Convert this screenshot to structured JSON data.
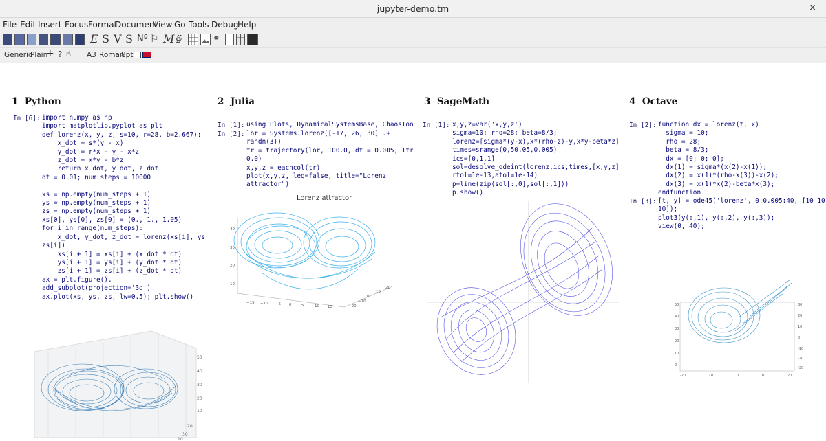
{
  "window": {
    "title": "jupyter-demo.tm",
    "close_glyph": "×"
  },
  "menu": [
    "File",
    "Edit",
    "Insert",
    "Focus",
    "Format",
    "Document",
    "View",
    "Go",
    "Tools",
    "Debug",
    "Help"
  ],
  "toolbar": {
    "letters": [
      "E",
      "S",
      "V",
      "S",
      "M"
    ],
    "icons": [
      "new-document-icon",
      "open-icon",
      "save-icon",
      "print-icon",
      "export-icon",
      "image-icon",
      "link-icon",
      "table-icon",
      "screen-icon"
    ]
  },
  "format_bar": {
    "style": "Generic",
    "mode": "Plain",
    "add_glyph": "+",
    "help_glyph": "?",
    "paper": "A3",
    "font": "Roman",
    "size": "8pt"
  },
  "sections": [
    {
      "number": "1",
      "title": "Python",
      "prompt": "In [6]:",
      "code": "import numpy as np\nimport matplotlib.pyplot as plt\ndef lorenz(x, y, z, s=10, r=28, b=2.667):\n    x_dot = s*(y - x)\n    y_dot = r*x - y - x*z\n    z_dot = x*y - b*z\n    return x_dot, y_dot, z_dot\ndt = 0.01; num_steps = 10000\n\nxs = np.empty(num_steps + 1)\nys = np.empty(num_steps + 1)\nzs = np.empty(num_steps + 1)\nxs[0], ys[0], zs[0] = (0., 1., 1.05)\nfor i in range(num_steps):\n    x_dot, y_dot, z_dot = lorenz(xs[i], ys[i],\nzs[i])\n    xs[i + 1] = xs[i] + (x_dot * dt)\n    ys[i + 1] = ys[i] + (y_dot * dt)\n    zs[i + 1] = zs[i] + (z_dot * dt)\nax = plt.figure().\nadd_subplot(projection='3d')\nax.plot(xs, ys, zs, lw=0.5); plt.show()"
    },
    {
      "number": "2",
      "title": "Julia",
      "prompt1": "In [1]:",
      "code1": "using Plots, DynamicalSystemsBase, ChaosTools",
      "prompt2": "In [2]:",
      "code2": "lor = Systems.lorenz([-17, 26, 30] .+\nrandn(3))\ntr = trajectory(lor, 100.0, dt = 0.005, Ttr =\n0.0)\nx,y,z = eachcol(tr)\nplot(x,y,z, leg=false, title=\"Lorenz\nattractor\")",
      "plot_title": "Lorenz attractor",
      "z_ticks": [
        "40",
        "30",
        "20",
        "10"
      ],
      "x_ticks": [
        "−15",
        "−10",
        "−5",
        "0",
        "5",
        "10",
        "15"
      ],
      "y_ticks": [
        "−20",
        "−10",
        "0",
        "10",
        "20"
      ]
    },
    {
      "number": "3",
      "title": "SageMath",
      "prompt": "In [1]:",
      "code": "x,y,z=var('x,y,z')\nsigma=10; rho=28; beta=8/3;\nlorenz=[sigma*(y-x),x*(rho-z)-y,x*y-beta*z]\ntimes=srange(0,50.05,0.005)\nics=[0,1,1]\nsol=desolve_odeint(lorenz,ics,times,[x,y,z],\nrtol=1e-13,atol=1e-14)\np=line(zip(sol[:,0],sol[:,1]))\np.show()"
    },
    {
      "number": "4",
      "title": "Octave",
      "prompt1": "In [2]:",
      "code1": "function dx = lorenz(t, x)\n  sigma = 10;\n  rho = 28;\n  beta = 8/3;\n  dx = [0; 0; 0];\n  dx(1) = sigma*(x(2)-x(1));\n  dx(2) = x(1)*(rho-x(3))-x(2);\n  dx(3) = x(1)*x(2)-beta*x(3);\nendfunction",
      "prompt2": "In [3]:",
      "code2": "[t, y] = ode45('lorenz', 0:0.005:40, [10 10\n10]);\nplot3(y(:,1), y(:,2), y(:,3));\nview(0, 40);",
      "z_ticks": [
        "50",
        "40",
        "30",
        "20",
        "10",
        "0"
      ],
      "x_ticks": [
        "-20",
        "-10",
        "0",
        "10",
        "20"
      ],
      "y_ticks": [
        "30",
        "20",
        "10",
        "0",
        "-10",
        "-20",
        "-30"
      ]
    }
  ],
  "python_plot_ticks": [
    "50",
    "40",
    "30",
    "20",
    "10",
    "20",
    "30",
    "10"
  ],
  "colors": {
    "python": "#1f6fb0",
    "julia": "#1aa3e8",
    "sage": "#2a2ae0",
    "octave": "#1a7fc0"
  }
}
